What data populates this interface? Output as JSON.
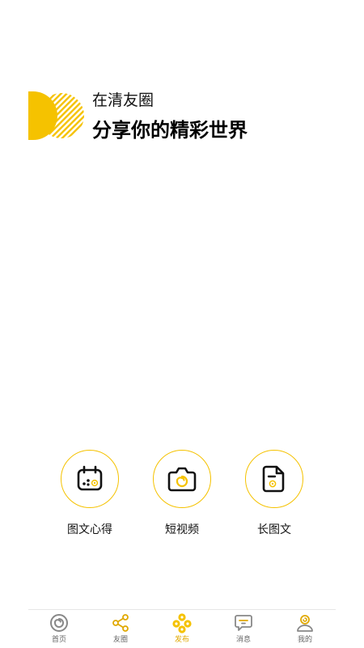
{
  "colors": {
    "accent": "#F5C200",
    "text": "#111111",
    "tab_inactive": "#666666",
    "tab_active": "#E0A800"
  },
  "hero": {
    "subtitle": "在清友圈",
    "title": "分享你的精彩世界"
  },
  "actions": [
    {
      "label": "图文心得",
      "icon": "calendar-icon"
    },
    {
      "label": "短视频",
      "icon": "camera-icon"
    },
    {
      "label": "长图文",
      "icon": "document-icon"
    }
  ],
  "tabbar": {
    "items": [
      {
        "label": "首页",
        "icon": "spiral-icon",
        "active": false
      },
      {
        "label": "友圈",
        "icon": "share-icon",
        "active": false
      },
      {
        "label": "发布",
        "icon": "publish-icon",
        "active": true
      },
      {
        "label": "消息",
        "icon": "message-icon",
        "active": false
      },
      {
        "label": "我的",
        "icon": "profile-icon",
        "active": false
      }
    ]
  }
}
